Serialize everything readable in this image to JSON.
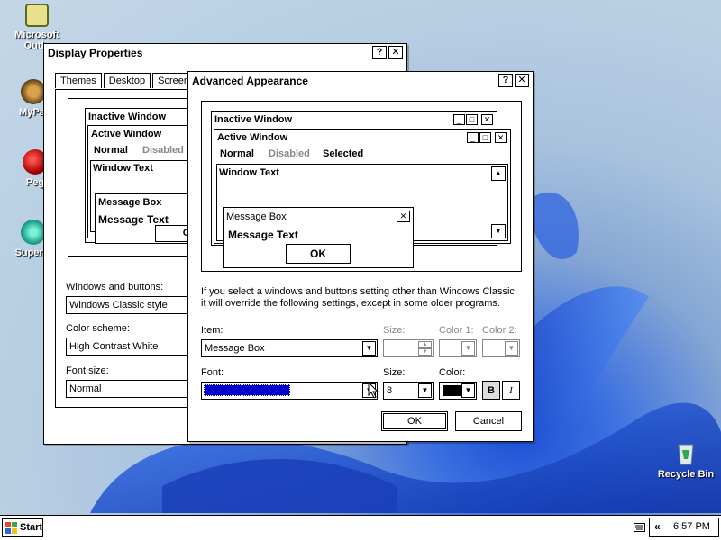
{
  "desktop": {
    "icons": [
      {
        "label1": "Microsoft",
        "label2": "Outlo",
        "icon": "outlook-icon"
      },
      {
        "label1": "MyPal",
        "label2": "",
        "icon": "mypal-icon"
      },
      {
        "label1": "Peg",
        "label2": "",
        "icon": "pegasus-icon"
      },
      {
        "label1": "Superm",
        "label2": "",
        "icon": "supermium-icon"
      },
      {
        "label1": "Recycle Bin",
        "label2": "",
        "icon": "recycle-bin-icon"
      }
    ]
  },
  "display_properties": {
    "title": "Display Properties",
    "help_btn": "?",
    "close_btn": "✕",
    "tabs": [
      "Themes",
      "Desktop",
      "Screen S"
    ],
    "preview": {
      "inactive_title": "Inactive Window",
      "active_title": "Active Window",
      "menu_normal": "Normal",
      "menu_disabled": "Disabled",
      "window_text": "Window Text",
      "msgbox_title": "Message Box",
      "msgbox_text": "Message Text",
      "ok_btn": "O"
    },
    "windows_buttons_label": "Windows and buttons:",
    "windows_buttons_value": "Windows Classic style",
    "color_scheme_label": "Color scheme:",
    "color_scheme_value": "High Contrast White",
    "font_size_label": "Font size:",
    "font_size_value": "Normal"
  },
  "advanced": {
    "title": "Advanced Appearance",
    "help_btn": "?",
    "close_btn": "✕",
    "preview": {
      "inactive_title": "Inactive Window",
      "active_title": "Active Window",
      "menu_normal": "Normal",
      "menu_disabled": "Disabled",
      "menu_selected": "Selected",
      "window_text": "Window Text",
      "msgbox_title": "Message Box",
      "msgbox_close": "✕",
      "msgbox_text": "Message Text",
      "ok_btn": "OK"
    },
    "info_line1": "If you select a windows and buttons setting other than Windows Classic,",
    "info_line2": "it will override the following settings, except in some older programs.",
    "item_label": "Item:",
    "item_value": "Message Box",
    "size_label_1": "Size:",
    "color1_label": "Color 1:",
    "color2_label": "Color 2:",
    "font_label": "Font:",
    "font_value": "",
    "size_label_2": "Size:",
    "size_value": "8",
    "color_label": "Color:",
    "bold_btn": "B",
    "italic_btn": "I",
    "ok_btn": "OK",
    "cancel_btn": "Cancel",
    "selection_color": "#0000cc"
  },
  "taskbar": {
    "start_label": "Start",
    "chevron": "«",
    "clock": "6:57 PM"
  }
}
